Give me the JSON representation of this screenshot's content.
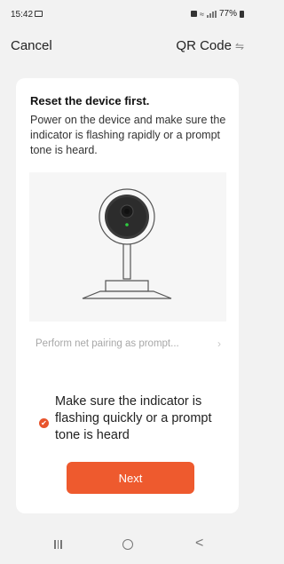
{
  "status_bar": {
    "time": "15:42",
    "battery": "77%"
  },
  "nav": {
    "cancel_label": "Cancel",
    "qr_label": "QR Code",
    "qr_icon_glyph": "⇋"
  },
  "card": {
    "title": "Reset the device first.",
    "description": "Power on the device and make sure the indicator is flashing rapidly or a prompt tone is heard.",
    "net_pairing_label": "Perform net pairing as prompt...",
    "chevron_glyph": "›",
    "confirm_checked": true,
    "confirm_text": "Make sure the indicator is flashing quickly or a prompt tone is heard",
    "next_label": "Next"
  },
  "system_nav": {
    "back_glyph": "<"
  },
  "colors": {
    "accent": "#ee5a2e",
    "background": "#f2f2f2",
    "card": "#ffffff"
  }
}
